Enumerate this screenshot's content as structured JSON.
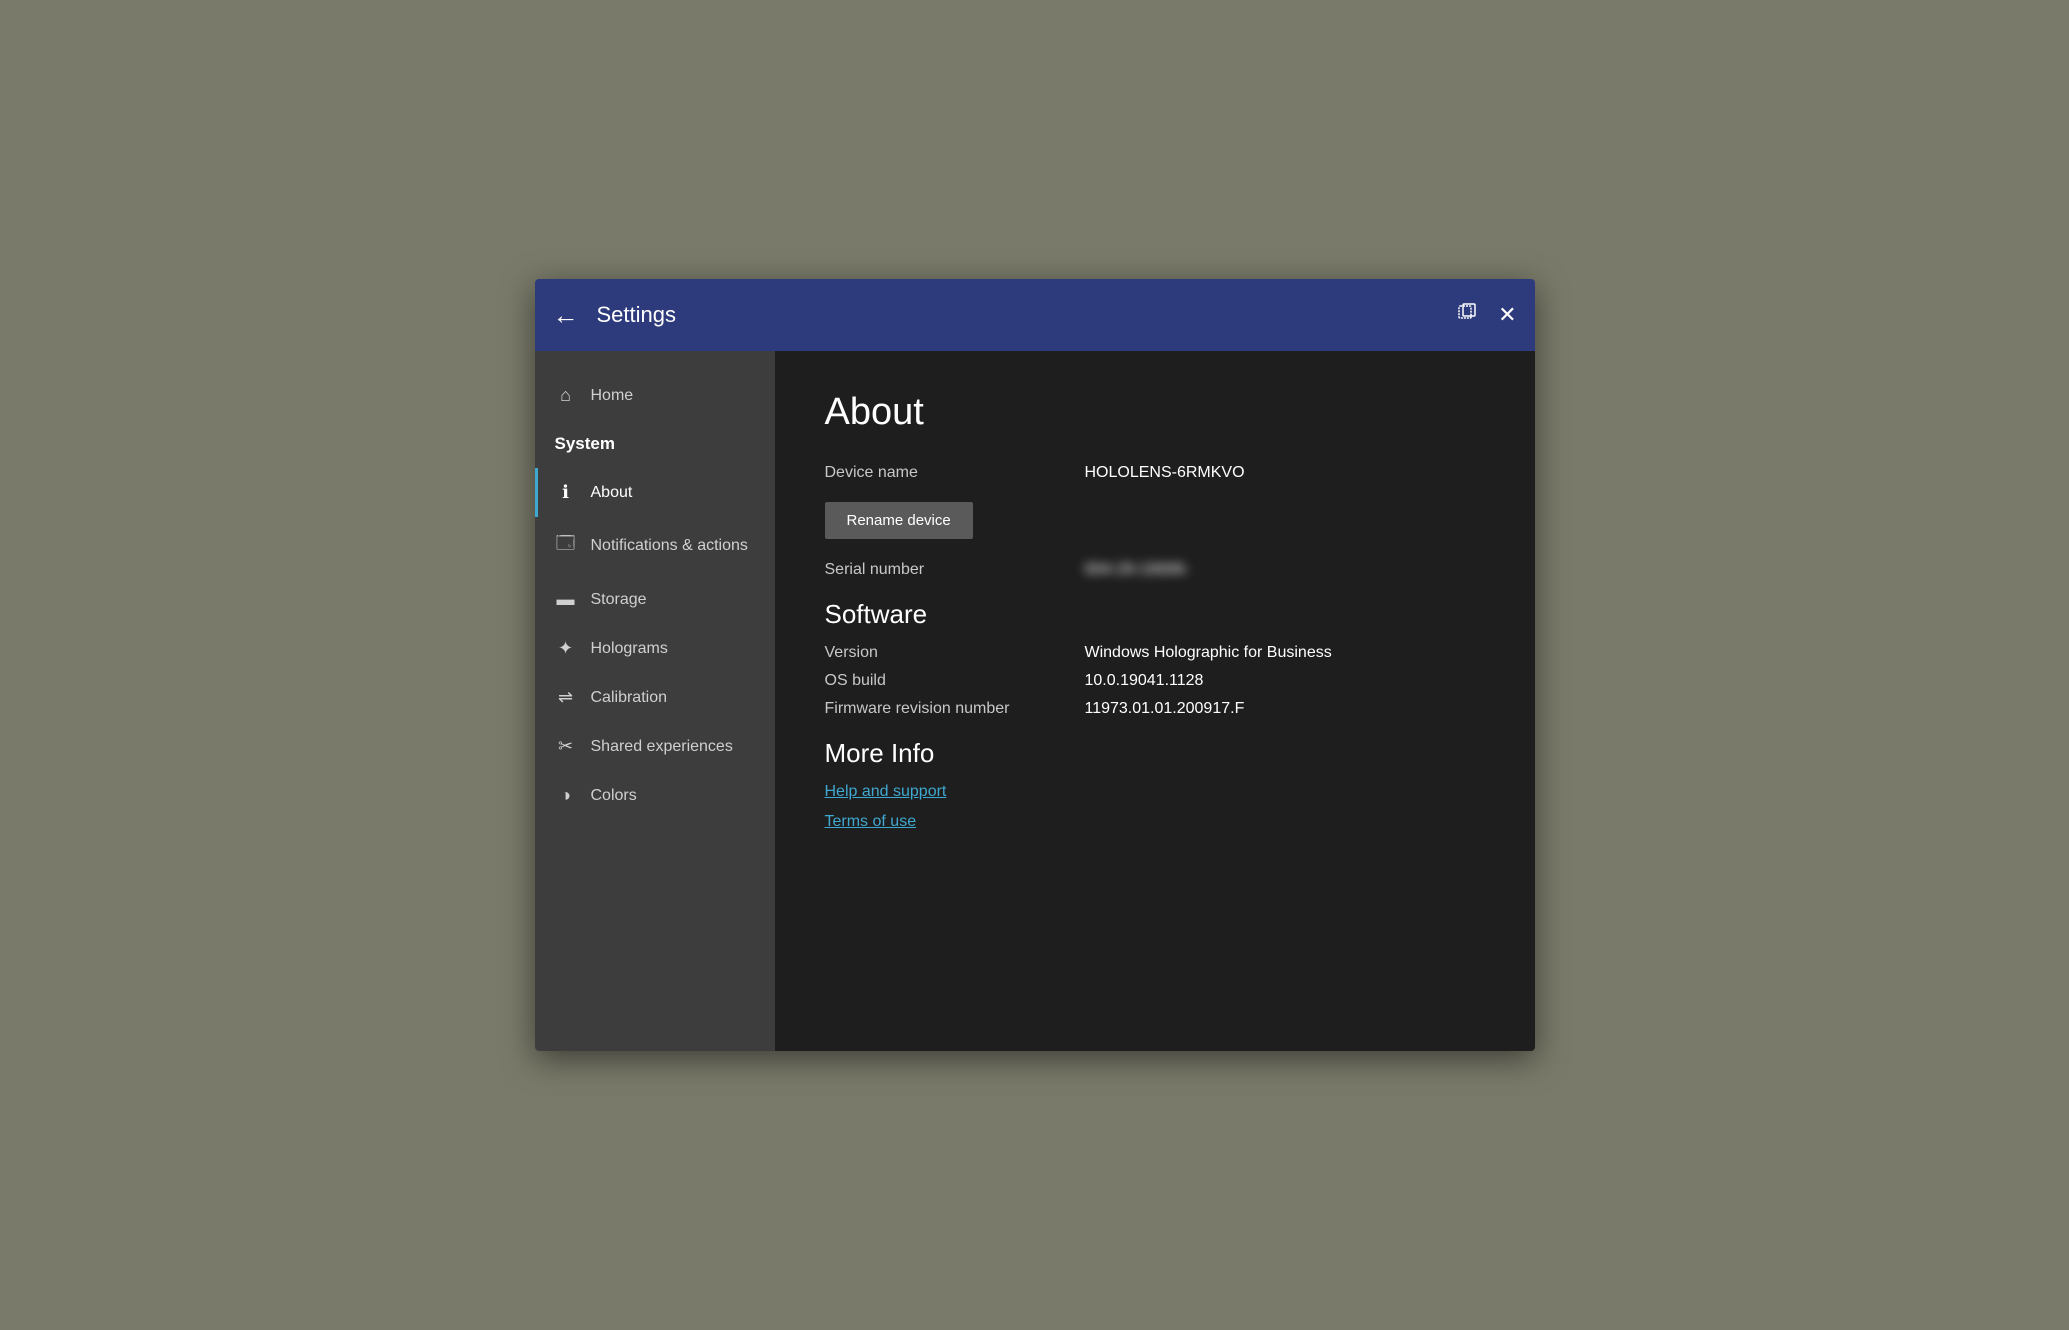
{
  "titlebar": {
    "back_label": "←",
    "title": "Settings",
    "restore_icon": "⬜",
    "close_icon": "✕"
  },
  "sidebar": {
    "home_label": "Home",
    "system_label": "System",
    "items": [
      {
        "id": "about",
        "label": "About",
        "icon": "ℹ",
        "active": true
      },
      {
        "id": "notifications",
        "label": "Notifications & actions",
        "icon": "🖵",
        "active": false
      },
      {
        "id": "storage",
        "label": "Storage",
        "icon": "▬",
        "active": false
      },
      {
        "id": "holograms",
        "label": "Holograms",
        "icon": "✦",
        "active": false
      },
      {
        "id": "calibration",
        "label": "Calibration",
        "icon": "⇌",
        "active": false
      },
      {
        "id": "shared",
        "label": "Shared experiences",
        "icon": "✂",
        "active": false
      },
      {
        "id": "colors",
        "label": "Colors",
        "icon": "◑",
        "active": false
      }
    ]
  },
  "main": {
    "page_title": "About",
    "device_name_label": "Device name",
    "device_name_value": "HOLOLENS-6RMKVO",
    "rename_button": "Rename device",
    "serial_number_label": "Serial number",
    "serial_number_value": "004-29-19006-",
    "software_title": "Software",
    "version_label": "Version",
    "version_value": "Windows Holographic for Business",
    "os_build_label": "OS build",
    "os_build_value": "10.0.19041.1128",
    "firmware_label": "Firmware revision number",
    "firmware_value": "11973.01.01.200917.F",
    "more_info_title": "More Info",
    "help_link": "Help and support",
    "terms_link": "Terms of use"
  }
}
